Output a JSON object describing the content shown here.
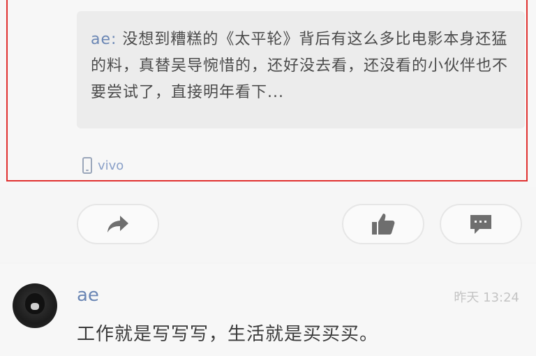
{
  "quoted": {
    "author": "ae:",
    "text": " 没想到糟糕的《太平轮》背后有这么多比电影本身还猛的料，真替吴导惋惜的，还好没去看，还没看的小伙伴也不要尝试了，直接明年看下..."
  },
  "device": {
    "icon": "phone-icon",
    "label": "vivo"
  },
  "actions": {
    "share_icon": "share-icon",
    "like_icon": "thumbs-up-icon",
    "comment_icon": "comment-icon"
  },
  "comment": {
    "username": "ae",
    "timestamp": "昨天 13:24",
    "text": "工作就是写写写，生活就是买买买。"
  },
  "colors": {
    "highlight": "#e0302f",
    "link": "#6a86b4"
  }
}
